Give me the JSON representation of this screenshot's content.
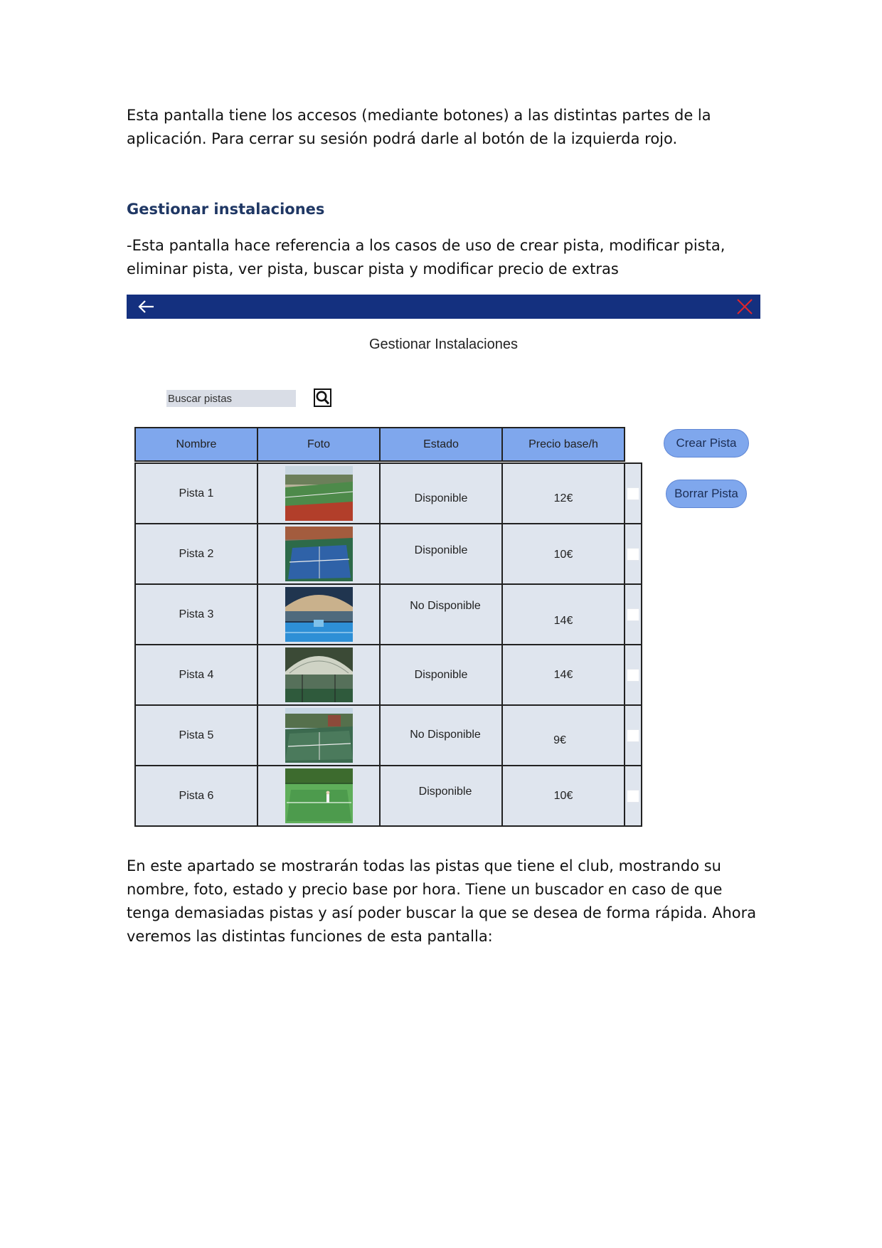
{
  "document": {
    "intro_paragraph": "Esta pantalla tiene los accesos (mediante botones) a las distintas partes de la aplicación. Para cerrar su sesión podrá darle al botón de la izquierda rojo.",
    "section_heading": "Gestionar instalaciones",
    "section_paragraph": "-Esta pantalla hace referencia a los casos de uso de crear pista, modificar pista, eliminar pista, ver pista, buscar pista y modificar precio de extras",
    "closing_paragraph": "En este apartado se mostrarán todas las pistas que tiene el club, mostrando su nombre, foto, estado y precio base por hora. Tiene un buscador en caso de que tenga demasiadas pistas y así poder buscar la que se desea de forma rápida. Ahora veremos las distintas funciones de esta pantalla:"
  },
  "mockup": {
    "title": "Gestionar Instalaciones",
    "topbar_color": "#14307f",
    "accent_color": "#7fa7ed",
    "close_color": "#e0262b",
    "back_icon": "arrow-left-icon",
    "close_icon": "close-icon",
    "search": {
      "placeholder": "Buscar pistas",
      "value": "",
      "icon": "magnifier-icon"
    },
    "table": {
      "headers": [
        "Nombre",
        "Foto",
        "Estado",
        "Precio base/h"
      ],
      "rows": [
        {
          "nombre": "Pista 1",
          "estado": "Disponible",
          "precio": "12€",
          "photo": "tennis court with red clay edge"
        },
        {
          "nombre": "Pista 2",
          "estado": "Disponible",
          "precio": "10€",
          "photo": "blue tennis court"
        },
        {
          "nombre": "Pista 3",
          "estado": "No Disponible",
          "precio": "14€",
          "photo": "covered blue padel court"
        },
        {
          "nombre": "Pista 4",
          "estado": "Disponible",
          "precio": "14€",
          "photo": "green padel court under dome"
        },
        {
          "nombre": "Pista 5",
          "estado": "No Disponible",
          "precio": "9€",
          "photo": "green tennis court with trees"
        },
        {
          "nombre": "Pista 6",
          "estado": "Disponible",
          "precio": "10€",
          "photo": "green court with player"
        }
      ]
    },
    "buttons": {
      "crear": "Crear Pista",
      "borrar": "Borrar Pista"
    }
  }
}
